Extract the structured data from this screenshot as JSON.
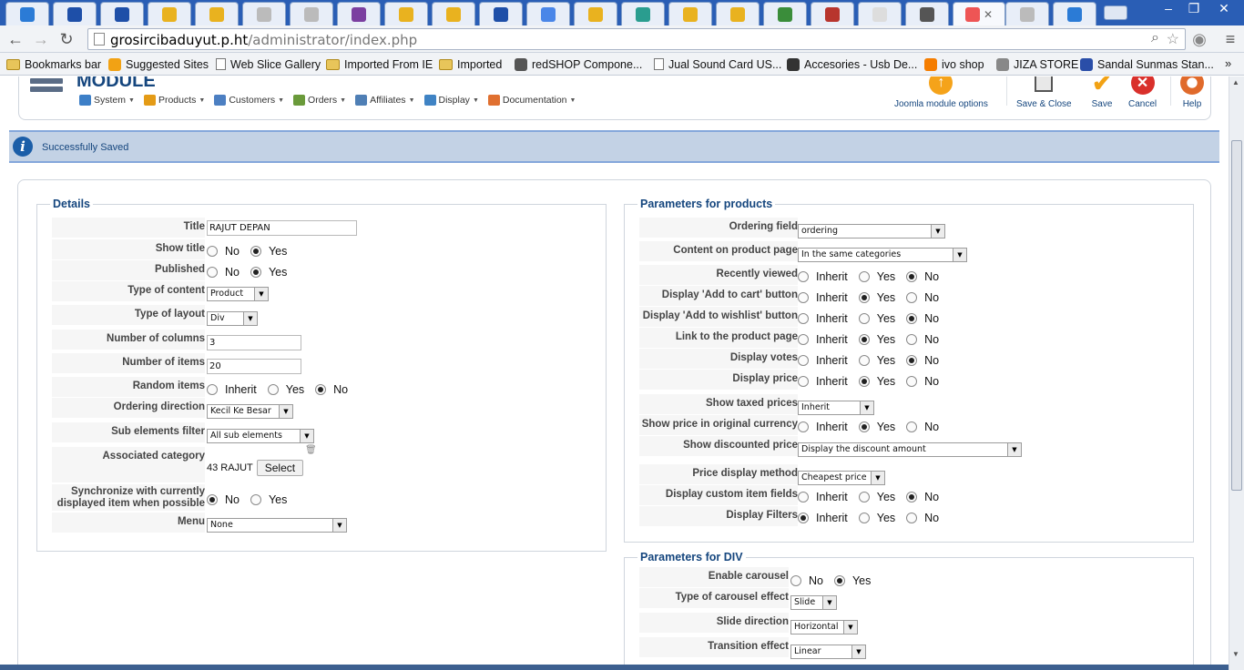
{
  "browser": {
    "tab_count": 23,
    "active_tab_index": 20,
    "address": {
      "host": "grosircibaduyut.p.ht",
      "path": "/administrator/index.php"
    },
    "bookmarks": [
      {
        "label": "Bookmarks bar",
        "icon": "folder-icon"
      },
      {
        "label": "Suggested Sites",
        "icon": "suggested-icon"
      },
      {
        "label": "Web Slice Gallery",
        "icon": "page-icon"
      },
      {
        "label": "Imported From IE",
        "icon": "folder-icon"
      },
      {
        "label": "Imported",
        "icon": "folder-icon"
      },
      {
        "label": "redSHOP Compone...",
        "icon": "globe-icon"
      },
      {
        "label": "Jual Sound Card US...",
        "icon": "page-icon"
      },
      {
        "label": "Accesories - Usb De...",
        "icon": "logo-icon"
      },
      {
        "label": "ivo shop",
        "icon": "blogger-icon"
      },
      {
        "label": "JIZA STORE",
        "icon": "cart-icon"
      },
      {
        "label": "Sandal Sunmas Stan...",
        "icon": "info-icon"
      }
    ],
    "more_bookmarks": "»"
  },
  "header": {
    "title": "MODULE",
    "menu": [
      {
        "label": "System",
        "icon": "tools-icon"
      },
      {
        "label": "Products",
        "icon": "products-icon"
      },
      {
        "label": "Customers",
        "icon": "customers-icon"
      },
      {
        "label": "Orders",
        "icon": "orders-icon"
      },
      {
        "label": "Affiliates",
        "icon": "affiliates-icon"
      },
      {
        "label": "Display",
        "icon": "display-icon"
      },
      {
        "label": "Documentation",
        "icon": "documentation-icon"
      }
    ],
    "toolbar": {
      "joomla_options": "Joomla module options",
      "save_close": "Save & Close",
      "save": "Save",
      "cancel": "Cancel",
      "help": "Help"
    }
  },
  "message": "Successfully Saved",
  "details": {
    "legend": "Details",
    "title_label": "Title",
    "title_value": "RAJUT DEPAN",
    "show_title_label": "Show title",
    "published_label": "Published",
    "type_content_label": "Type of content",
    "type_content_value": "Product",
    "type_layout_label": "Type of layout",
    "type_layout_value": "Div",
    "columns_label": "Number of columns",
    "columns_value": "3",
    "items_label": "Number of items",
    "items_value": "20",
    "random_label": "Random items",
    "ordering_dir_label": "Ordering direction",
    "ordering_dir_value": "Kecil Ke Besar",
    "sub_filter_label": "Sub elements filter",
    "sub_filter_value": "All sub elements",
    "assoc_cat_label": "Associated category",
    "assoc_cat_value": "43 RAJUT",
    "select_button": "Select",
    "sync_label_1": "Synchronize with currently",
    "sync_label_2": "displayed item when possible",
    "menu_label": "Menu",
    "menu_value": "None"
  },
  "options": {
    "no": "No",
    "yes": "Yes",
    "inherit": "Inherit"
  },
  "products": {
    "legend": "Parameters for products",
    "ordering_label": "Ordering field",
    "ordering_value": "ordering",
    "content_label": "Content on product page",
    "content_value": "In the same categories",
    "recent_label": "Recently viewed",
    "add_cart_label": "Display 'Add to cart' button",
    "add_wish_label": "Display 'Add to wishlist' button",
    "link_label": "Link to the product page",
    "votes_label": "Display votes",
    "price_label": "Display price",
    "taxed_label": "Show taxed prices",
    "taxed_value": "Inherit",
    "orig_label": "Show price in original currency",
    "discount_label": "Show discounted price",
    "discount_value": "Display the discount amount",
    "method_label": "Price display method",
    "method_value": "Cheapest price",
    "custom_label": "Display custom item fields",
    "filters_label": "Display Filters"
  },
  "div": {
    "legend": "Parameters for DIV",
    "carousel_label": "Enable carousel",
    "effect_label": "Type of carousel effect",
    "effect_value": "Slide",
    "direction_label": "Slide direction",
    "direction_value": "Horizontal",
    "transition_label": "Transition effect",
    "transition_value": "Linear"
  },
  "colors": {
    "accent": "#15467e",
    "tabbar": "#2a5eb5",
    "message_bg": "#c3d2e5"
  }
}
